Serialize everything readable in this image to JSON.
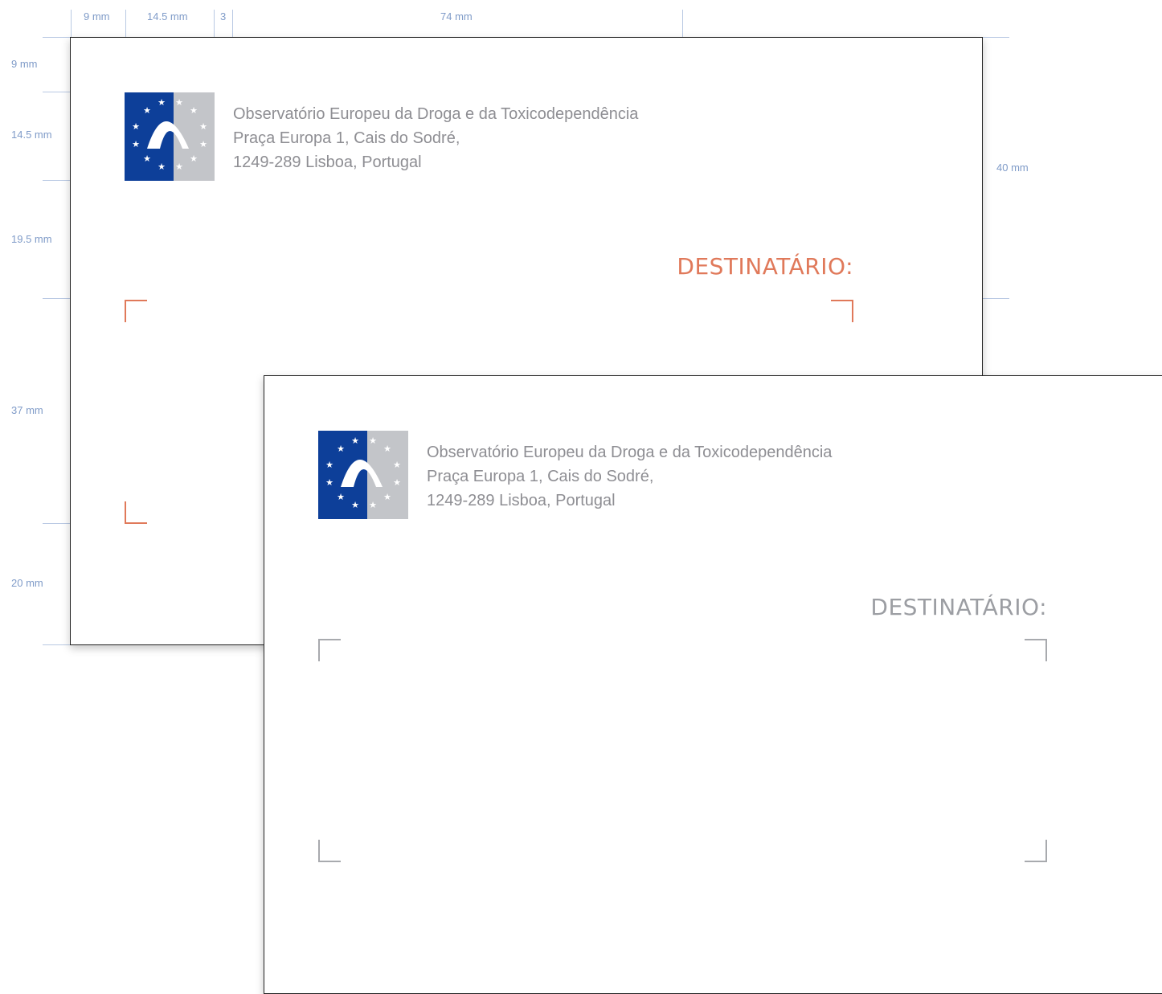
{
  "dimensions": {
    "top": [
      "9 mm",
      "14.5 mm",
      "3",
      "74 mm"
    ],
    "left": [
      "9 mm",
      "14.5 mm",
      "19.5 mm",
      "37 mm",
      "20 mm"
    ],
    "right": [
      "40 mm"
    ]
  },
  "envelope": {
    "sender_lines": [
      "Observatório Europeu da Droga e da Toxicodependência",
      "Praça Europa 1, Cais do Sodré,",
      "1249-289 Lisboa, Portugal"
    ],
    "recipient_label": "DESTINATÁRIO:",
    "logo_icon": "emcdda-logo-icon"
  },
  "colors": {
    "logo_blue": "#0d3f99",
    "logo_grey": "#c3c5c9",
    "accent_orange": "#e0795a",
    "corner_grey": "#a8aaae",
    "guide_blue": "#7f9bc8"
  }
}
